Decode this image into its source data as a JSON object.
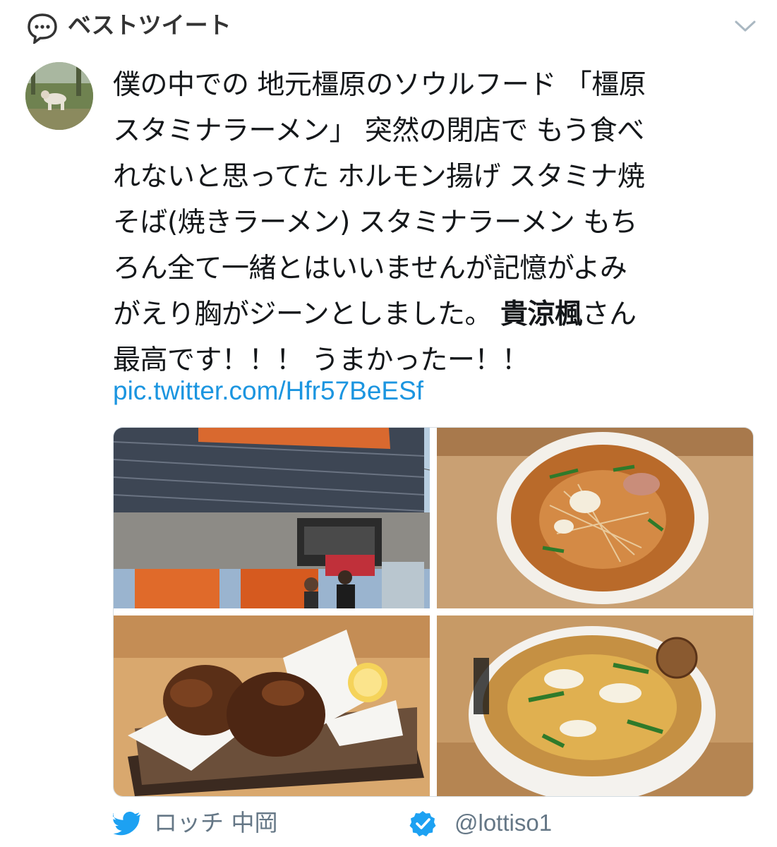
{
  "header": {
    "title": "ベストツイート",
    "icons": {
      "left": "speech-bubble-icon",
      "right": "chevron-down-icon"
    }
  },
  "tweet": {
    "lines": [
      "僕の中での 地元橿原のソウルフード 「橿原",
      "スタミナラーメン」 突然の閉店で もう食べ",
      "れないと思ってた ホルモン揚げ スタミナ焼",
      "そば(焼きラーメン) スタミナラーメン もち",
      "ろん全て一緒とはいいませんが記憶がよみ"
    ],
    "line6_before": "がえり胸がジーンとしました。 ",
    "mention": "貴涼楓",
    "line6_after": "さん",
    "line7": "最高です！！！ うまかったー！！",
    "link": "pic.twitter.com/Hfr57BeESf"
  },
  "media": [
    {
      "name": "restaurant-storefront-photo"
    },
    {
      "name": "stamina-yakisoba-photo"
    },
    {
      "name": "horumon-age-photo"
    },
    {
      "name": "stamina-ramen-photo"
    }
  ],
  "author": {
    "name": "ロッチ 中岡",
    "handle": "@lottiso1",
    "verified": true,
    "icons": {
      "bird": "twitter-bird-icon",
      "verified": "verified-badge-icon"
    }
  },
  "colors": {
    "link": "#1b95e0",
    "muted": "#657786",
    "text": "#14171a"
  }
}
